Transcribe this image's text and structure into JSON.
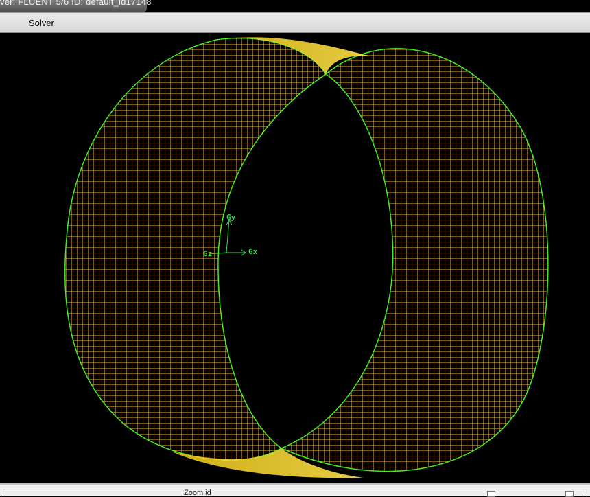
{
  "window": {
    "title": "ver: FLUENT 5/6   ID: default_id17148"
  },
  "menu": {
    "items": [
      {
        "accel": "S",
        "rest": "olver"
      }
    ]
  },
  "viewport": {
    "axes": {
      "x_label": "Gx",
      "y_label": "Gy",
      "z_label": "Gz"
    },
    "colors": {
      "background": "#000000",
      "mesh_fill": "#ffcc55",
      "mesh_edge": "#dddd22",
      "outline": "#44ee22",
      "triad": "#33dd55"
    }
  },
  "status": {
    "text": "Zoom  id"
  }
}
